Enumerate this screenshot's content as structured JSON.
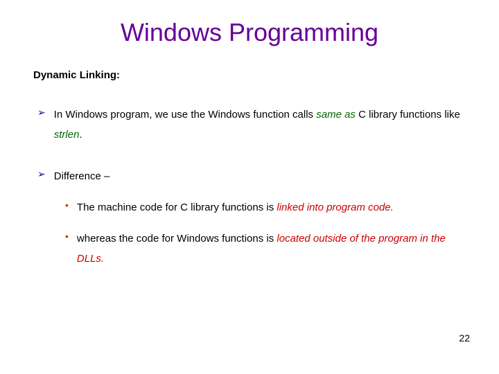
{
  "title": "Windows Programming",
  "subheading": "Dynamic Linking:",
  "bullets": {
    "b1_pre": "In Windows program, we use the Windows function calls ",
    "b1_em": "same as",
    "b1_post": " C library functions like ",
    "b1_em2": "strlen",
    "b1_tail": ".",
    "b2": "Difference –",
    "sub1_pre": "The machine code for C library functions is ",
    "sub1_em": "linked into program code.",
    "sub2_pre": "whereas the code for Windows functions is ",
    "sub2_em": "located outside of the program in the DLLs."
  },
  "glyphs": {
    "arrow": "➢",
    "disc": "•"
  },
  "page_number": "22"
}
